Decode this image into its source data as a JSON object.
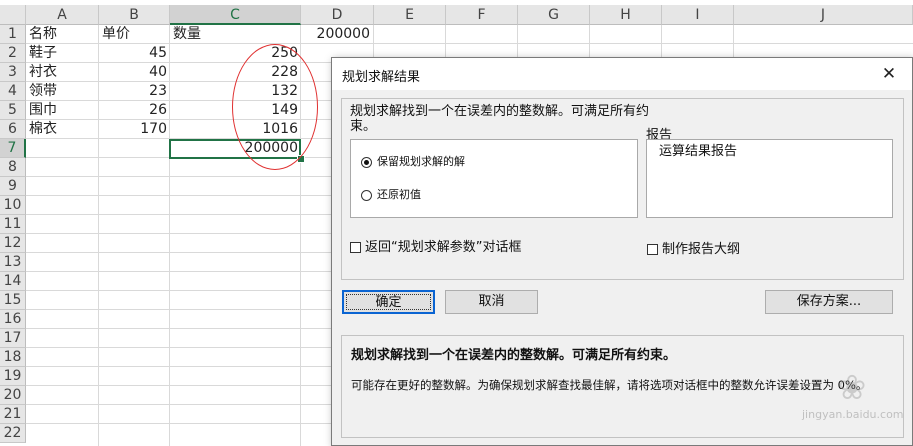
{
  "sheet": {
    "columns": [
      "A",
      "B",
      "C",
      "D",
      "E",
      "F",
      "G",
      "H",
      "I",
      "J"
    ],
    "selected_column": "C",
    "rows": [
      "1",
      "2",
      "3",
      "4",
      "5",
      "6",
      "7",
      "8",
      "9",
      "10",
      "11",
      "12",
      "13",
      "14",
      "15",
      "16",
      "17",
      "18",
      "19",
      "20",
      "21",
      "22"
    ],
    "selected_row": "7",
    "headers": {
      "name": "名称",
      "price": "单价",
      "qty": "数量",
      "d1": "200000"
    },
    "data": [
      {
        "name": "鞋子",
        "price": "45",
        "qty": "250"
      },
      {
        "name": "衬衣",
        "price": "40",
        "qty": "228"
      },
      {
        "name": "领带",
        "price": "23",
        "qty": "132"
      },
      {
        "name": "围巾",
        "price": "26",
        "qty": "149"
      },
      {
        "name": "棉衣",
        "price": "170",
        "qty": "1016"
      }
    ],
    "total": "200000"
  },
  "dialog": {
    "title": "规划求解结果",
    "close": "✕",
    "message": "规划求解找到一个在误差内的整数解。可满足所有约束。",
    "radio_keep": "保留规划求解的解",
    "radio_restore": "还原初值",
    "report_label": "报告",
    "report_item": "运算结果报告",
    "checkbox_return": "返回“规划求解参数”对话框",
    "checkbox_outline": "制作报告大纲",
    "btn_ok": "确定",
    "btn_cancel": "取消",
    "btn_save": "保存方案...",
    "result_bold": "规划求解找到一个在误差内的整数解。可满足所有约束。",
    "result_hint": "可能存在更好的整数解。为确保规划求解查找最佳解，请将选项对话框中的整数允许误差设置为 0%。"
  },
  "watermark": {
    "text": "jingyan.baidu.com"
  }
}
